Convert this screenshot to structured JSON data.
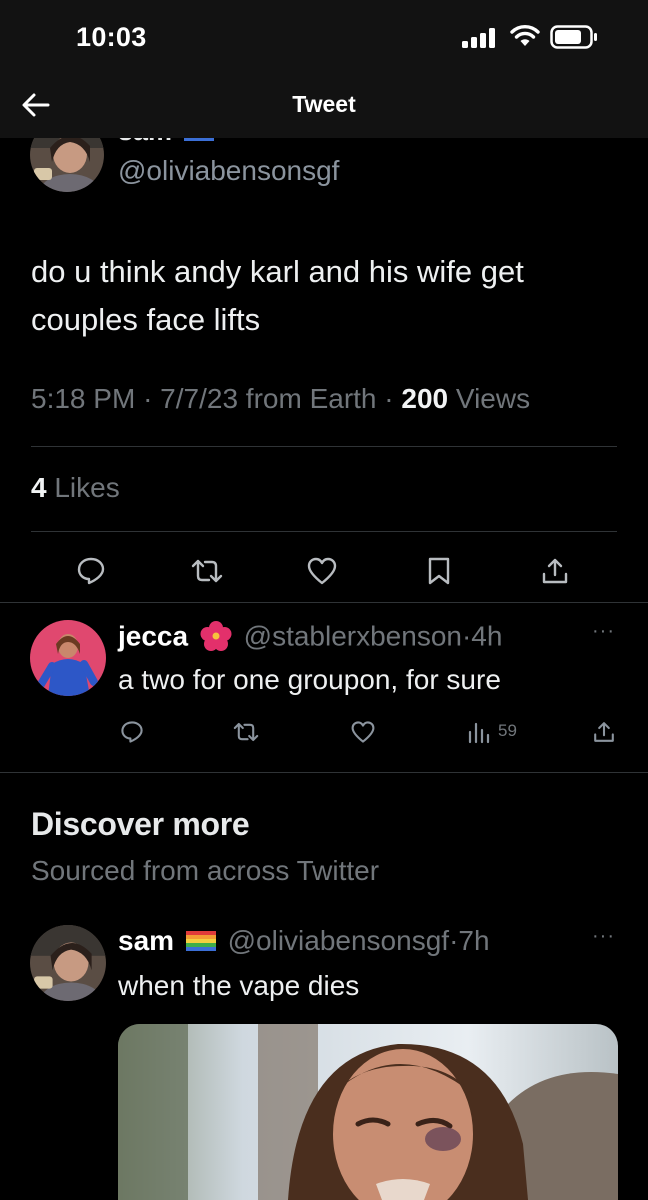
{
  "status_bar": {
    "time": "10:03"
  },
  "header": {
    "title": "Tweet"
  },
  "main_tweet": {
    "display_name_partial": "sam",
    "handle": "@oliviabensonsgf",
    "text": "do u think andy karl and his wife get couples face lifts",
    "meta_time": "5:18 PM",
    "meta_sep": "·",
    "meta_date_source": "7/7/23 from Earth",
    "views_count": "200",
    "views_label": "Views",
    "likes_count": "4",
    "likes_label": "Likes"
  },
  "reply": {
    "display_name": "jecca",
    "handle": "@stablerxbenson",
    "sep": "·",
    "age": "4h",
    "more": "···",
    "text": "a two for one groupon, for sure",
    "views": "59"
  },
  "discover": {
    "title": "Discover more",
    "subtitle": "Sourced from across Twitter"
  },
  "discover_tweet": {
    "display_name": "sam",
    "handle": "@oliviabensonsgf",
    "sep": "·",
    "age": "7h",
    "more": "···",
    "text": "when the vape dies"
  },
  "colors": {
    "background": "#000000",
    "text_primary": "#e7e9ea",
    "text_secondary": "#71767b",
    "divider": "#2f3336",
    "icon": "#71767b"
  }
}
